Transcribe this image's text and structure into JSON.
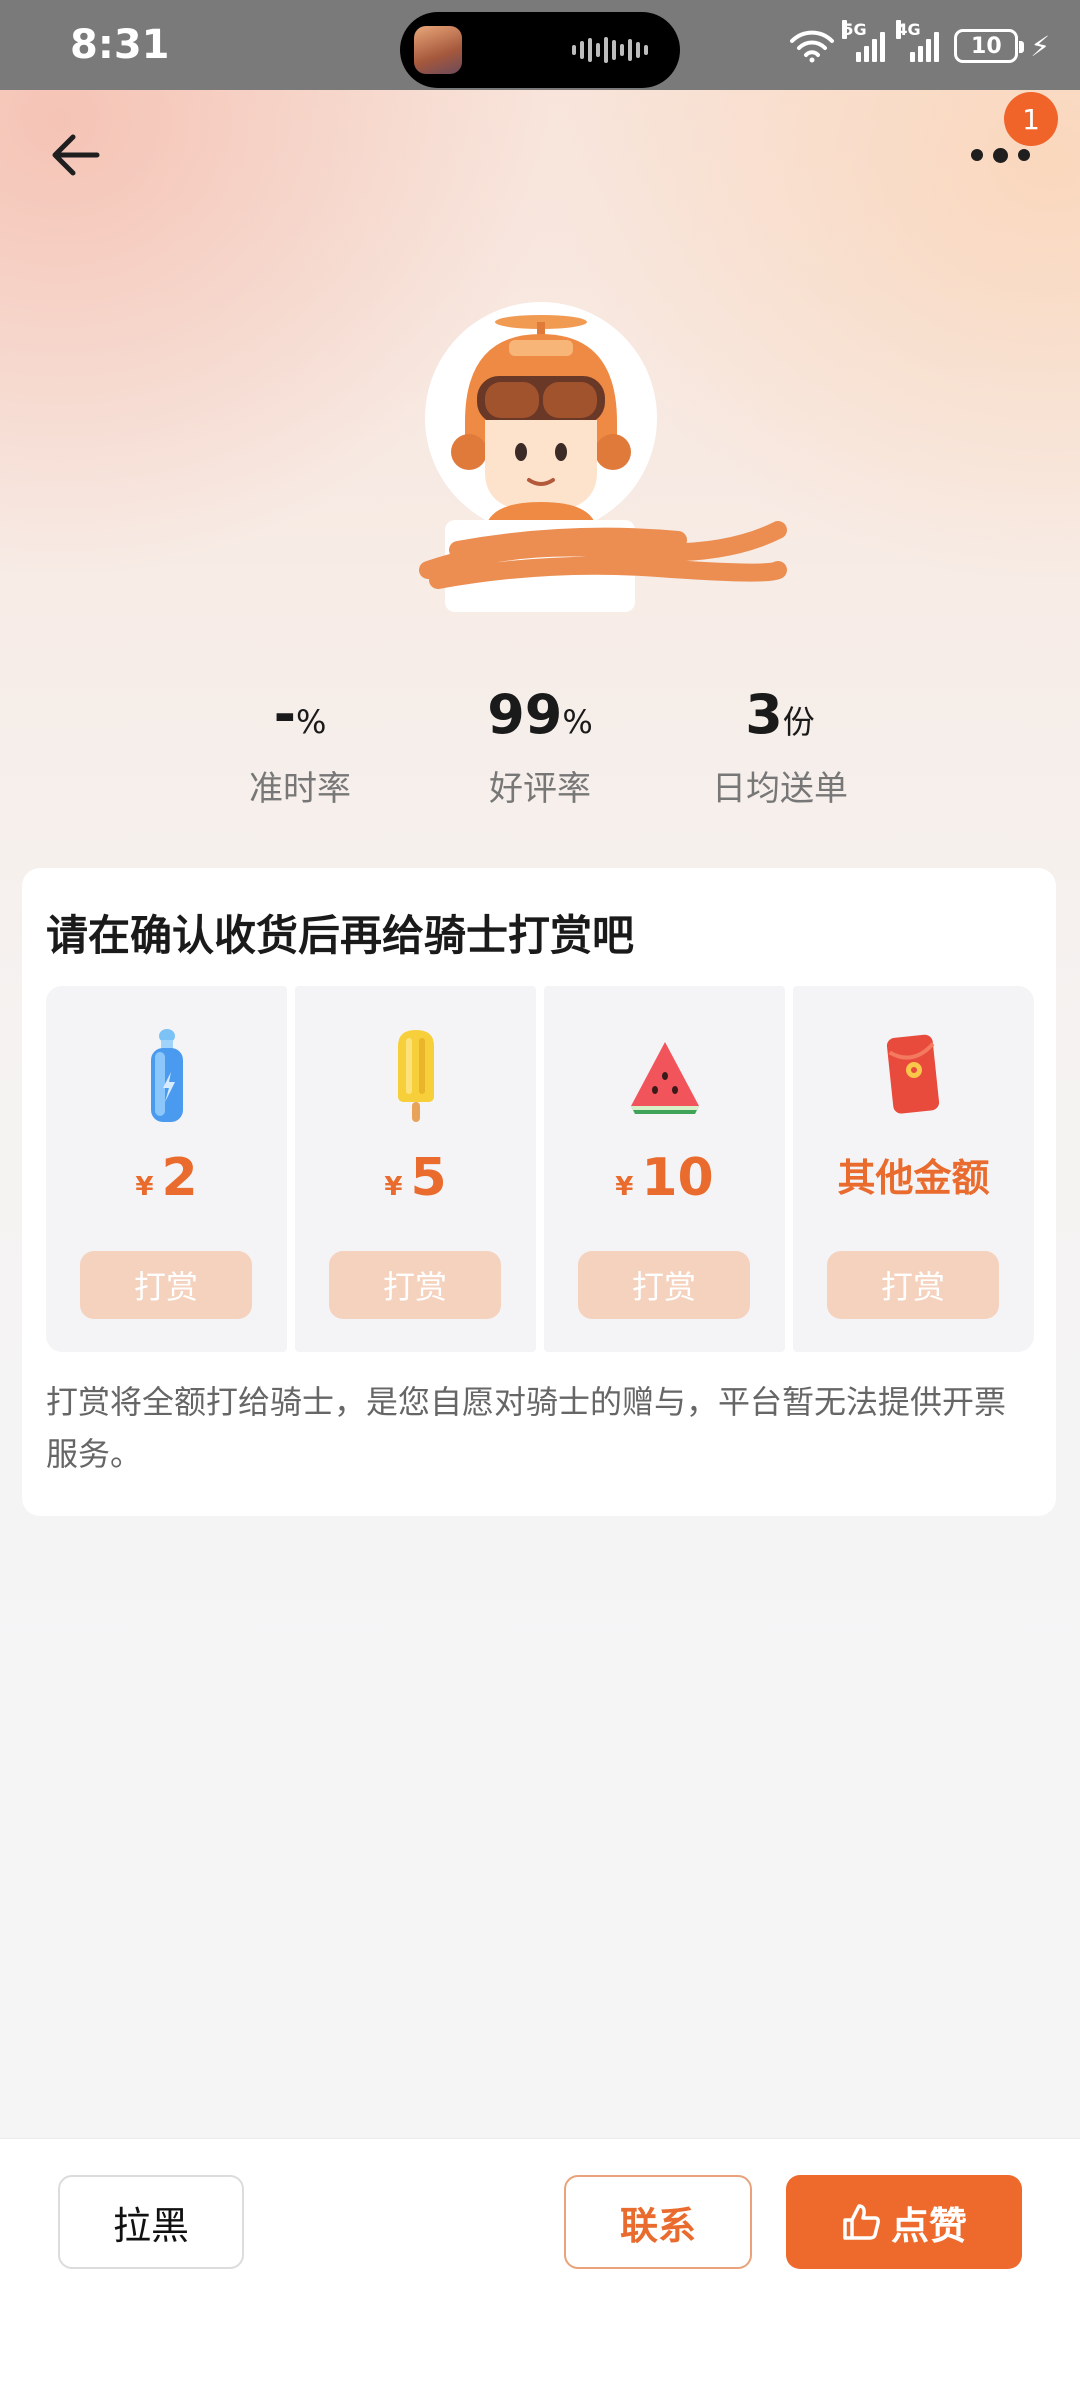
{
  "status_bar": {
    "time": "8:31",
    "net_5g": "5G",
    "net_4g": "4G",
    "battery": "10"
  },
  "nav": {
    "badge_count": "1"
  },
  "stats": [
    {
      "value": "-",
      "unit": "%",
      "label": "准时率"
    },
    {
      "value": "99",
      "unit": "%",
      "label": "好评率"
    },
    {
      "value": "3",
      "unit": "份",
      "label": "日均送单"
    }
  ],
  "tip": {
    "title": "请在确认收货后再给骑士打赏吧",
    "options": [
      {
        "icon": "water-bottle-icon",
        "currency": "¥",
        "amount": "2",
        "button": "打赏"
      },
      {
        "icon": "popsicle-icon",
        "currency": "¥",
        "amount": "5",
        "button": "打赏"
      },
      {
        "icon": "watermelon-icon",
        "currency": "¥",
        "amount": "10",
        "button": "打赏"
      },
      {
        "icon": "red-envelope-icon",
        "amount": "其他金额",
        "button": "打赏"
      }
    ],
    "note": "打赏将全额打给骑士，是您自愿对骑士的赠与，平台暂无法提供开票服务。"
  },
  "bottom": {
    "block_label": "拉黑",
    "contact_label": "联系",
    "like_label": "点赞"
  },
  "colors": {
    "accent": "#ee6a2c",
    "price": "#e96b2e",
    "tip_button": "#f5d2bd"
  }
}
